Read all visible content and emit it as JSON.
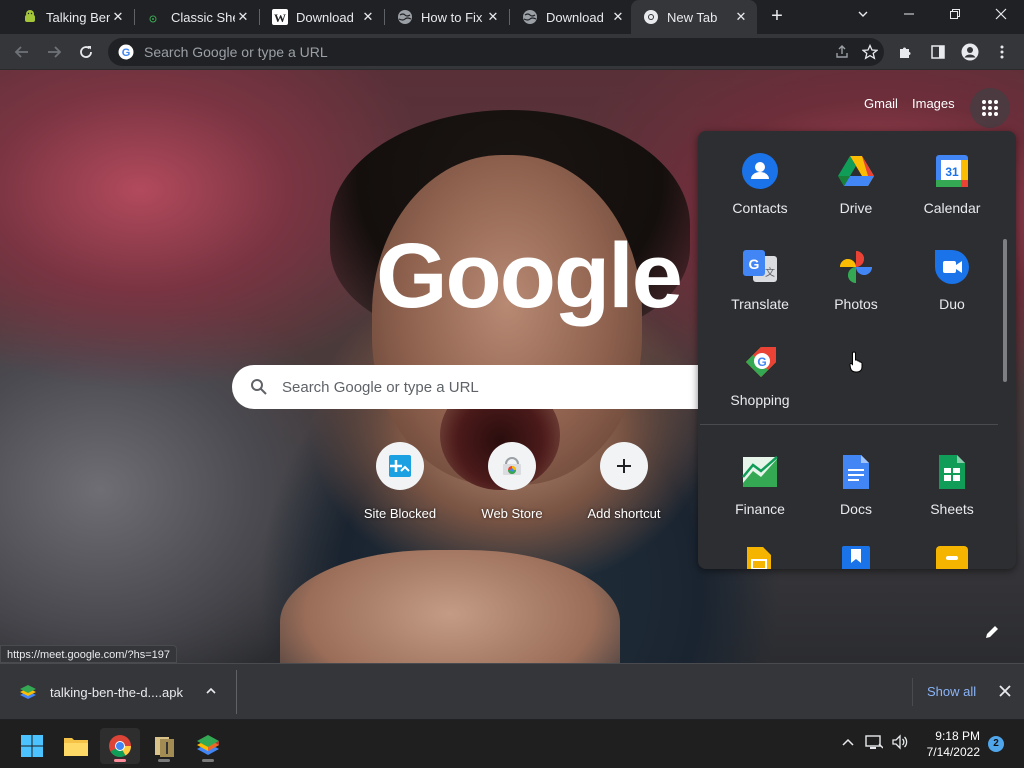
{
  "tabs": [
    {
      "title": "Talking Ben",
      "icon": "android-icon",
      "active": false
    },
    {
      "title": "Classic Shel",
      "icon": "shell-icon",
      "active": false
    },
    {
      "title": "Download",
      "icon": "wikihow-icon",
      "active": false
    },
    {
      "title": "How to Fix",
      "icon": "globe-icon",
      "active": false
    },
    {
      "title": "Download",
      "icon": "globe-icon",
      "active": false
    },
    {
      "title": "New Tab",
      "icon": "chrome-icon",
      "active": true
    }
  ],
  "omnibox": {
    "placeholder": "Search Google or type a URL"
  },
  "ntp": {
    "gmail": "Gmail",
    "images": "Images",
    "logo": "Google",
    "search_placeholder": "Search Google or type a URL",
    "shortcuts": [
      {
        "label": "Site Blocked",
        "icon": "site-blocked-icon"
      },
      {
        "label": "Web Store",
        "icon": "web-store-icon"
      },
      {
        "label": "Add shortcut",
        "icon": "plus-icon"
      }
    ],
    "status_url": "https://meet.google.com/?hs=197"
  },
  "apps": [
    {
      "label": "Contacts",
      "icon": "contacts-icon"
    },
    {
      "label": "Drive",
      "icon": "drive-icon"
    },
    {
      "label": "Calendar",
      "icon": "calendar-icon",
      "badge": "31"
    },
    {
      "label": "Translate",
      "icon": "translate-icon"
    },
    {
      "label": "Photos",
      "icon": "photos-icon"
    },
    {
      "label": "Duo",
      "icon": "duo-icon"
    },
    {
      "label": "Shopping",
      "icon": "shopping-icon"
    },
    {
      "label": "Finance",
      "icon": "finance-icon"
    },
    {
      "label": "Docs",
      "icon": "docs-icon"
    },
    {
      "label": "Sheets",
      "icon": "sheets-icon"
    }
  ],
  "download": {
    "filename": "talking-ben-the-d....apk",
    "show_all": "Show all"
  },
  "taskbar": {
    "time": "9:18 PM",
    "date": "7/14/2022",
    "notifications": "2"
  },
  "colors": {
    "accent_link": "#8ab4f8",
    "tab_bg": "#202124",
    "toolbar_bg": "#35363a"
  }
}
